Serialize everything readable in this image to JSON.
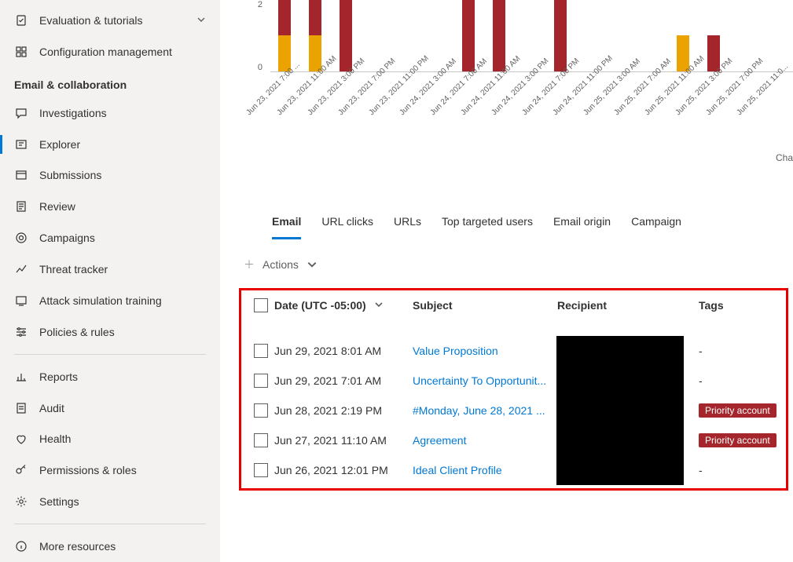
{
  "sidebar": {
    "section_top": [
      {
        "label": "Evaluation & tutorials",
        "icon": "clipboard-check-icon",
        "expandable": true
      },
      {
        "label": "Configuration management",
        "icon": "grid-icon"
      }
    ],
    "section_label": "Email & collaboration",
    "items": [
      {
        "label": "Investigations",
        "icon": "chat-icon"
      },
      {
        "label": "Explorer",
        "icon": "explorer-icon",
        "active": true
      },
      {
        "label": "Submissions",
        "icon": "submission-icon"
      },
      {
        "label": "Review",
        "icon": "review-icon"
      },
      {
        "label": "Campaigns",
        "icon": "target-icon"
      },
      {
        "label": "Threat tracker",
        "icon": "trend-icon"
      },
      {
        "label": "Attack simulation training",
        "icon": "attack-icon"
      },
      {
        "label": "Policies & rules",
        "icon": "sliders-icon"
      }
    ],
    "section_bottom": [
      {
        "label": "Reports",
        "icon": "chart-icon"
      },
      {
        "label": "Audit",
        "icon": "audit-icon"
      },
      {
        "label": "Health",
        "icon": "health-icon"
      },
      {
        "label": "Permissions & roles",
        "icon": "key-icon"
      },
      {
        "label": "Settings",
        "icon": "gear-icon"
      }
    ],
    "more": {
      "label": "More resources",
      "icon": "info-icon"
    }
  },
  "chart_data": {
    "type": "bar",
    "stacked": true,
    "ylabel": "",
    "ylim": [
      0,
      2
    ],
    "y_ticks": [
      "2",
      "0"
    ],
    "categories": [
      "Jun 23, 2021 7:00 ...",
      "Jun 23, 2021 11:00 AM",
      "Jun 23, 2021 3:00 PM",
      "Jun 23, 2021 7:00 PM",
      "Jun 23, 2021 11:00 PM",
      "Jun 24, 2021 3:00 AM",
      "Jun 24, 2021 7:00 AM",
      "Jun 24, 2021 11:00 AM",
      "Jun 24, 2021 3:00 PM",
      "Jun 24, 2021 7:00 PM",
      "Jun 24, 2021 11:00 PM",
      "Jun 25, 2021 3:00 AM",
      "Jun 25, 2021 7:00 AM",
      "Jun 25, 2021 11:00 AM",
      "Jun 25, 2021 3:00 PM",
      "Jun 25, 2021 7:00 PM",
      "Jun 25, 2021 11:0..."
    ],
    "series": [
      {
        "name": "red",
        "color": "#a4262c",
        "values": [
          2,
          2,
          2,
          0,
          0,
          0,
          2,
          2,
          0,
          2,
          0,
          0,
          0,
          0,
          1,
          0,
          0
        ]
      },
      {
        "name": "amber",
        "color": "#eaa300",
        "values": [
          1,
          1,
          0,
          0,
          0,
          0,
          0,
          0,
          0,
          0,
          0,
          0,
          0,
          1,
          0,
          0,
          0
        ]
      }
    ],
    "footer_note": "Cha"
  },
  "tabs": [
    {
      "label": "Email",
      "active": true
    },
    {
      "label": "URL clicks"
    },
    {
      "label": "URLs"
    },
    {
      "label": "Top targeted users"
    },
    {
      "label": "Email origin"
    },
    {
      "label": "Campaign"
    }
  ],
  "actions": {
    "label": "Actions"
  },
  "table": {
    "columns": {
      "date": "Date (UTC -05:00)",
      "subject": "Subject",
      "recipient": "Recipient",
      "tags": "Tags"
    },
    "rows": [
      {
        "date": "Jun 29, 2021 8:01 AM",
        "subject": "Value Proposition",
        "tag": "-"
      },
      {
        "date": "Jun 29, 2021 7:01 AM",
        "subject": "Uncertainty To Opportunit...",
        "tag": "-"
      },
      {
        "date": "Jun 28, 2021 2:19 PM",
        "subject": "#Monday, June 28, 2021 ...",
        "tag": "Priority account"
      },
      {
        "date": "Jun 27, 2021 11:10 AM",
        "subject": "Agreement",
        "tag": "Priority account"
      },
      {
        "date": "Jun 26, 2021 12:01 PM",
        "subject": "Ideal Client Profile",
        "tag": "-"
      }
    ]
  }
}
